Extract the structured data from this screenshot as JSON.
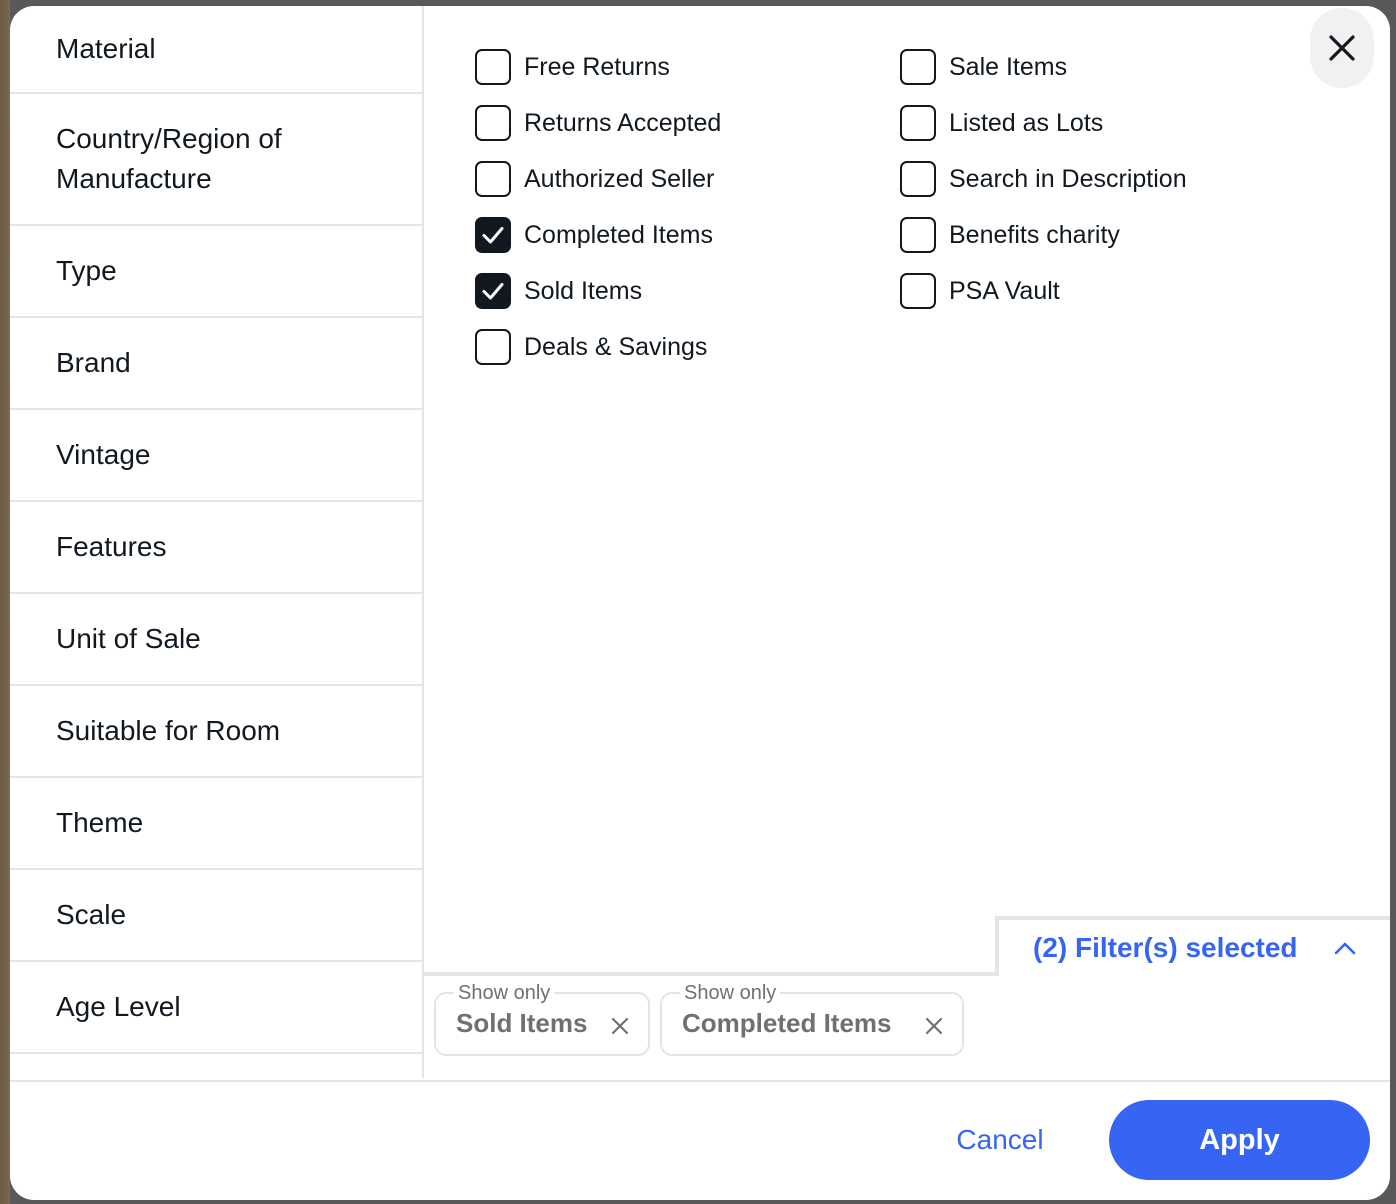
{
  "sidebar": {
    "items": [
      {
        "label": "Material"
      },
      {
        "label": "Country/Region of Manufacture"
      },
      {
        "label": "Type"
      },
      {
        "label": "Brand"
      },
      {
        "label": "Vintage"
      },
      {
        "label": "Features"
      },
      {
        "label": "Unit of Sale"
      },
      {
        "label": "Suitable for Room"
      },
      {
        "label": "Theme"
      },
      {
        "label": "Scale"
      },
      {
        "label": "Age Level"
      }
    ]
  },
  "options": {
    "left": [
      {
        "label": "Free Returns",
        "checked": false
      },
      {
        "label": "Returns Accepted",
        "checked": false
      },
      {
        "label": "Authorized Seller",
        "checked": false
      },
      {
        "label": "Completed Items",
        "checked": true
      },
      {
        "label": "Sold Items",
        "checked": true
      },
      {
        "label": "Deals & Savings",
        "checked": false
      }
    ],
    "right": [
      {
        "label": "Sale Items",
        "checked": false
      },
      {
        "label": "Listed as Lots",
        "checked": false
      },
      {
        "label": "Search in Description",
        "checked": false
      },
      {
        "label": "Benefits charity",
        "checked": false
      },
      {
        "label": "PSA Vault",
        "checked": false
      }
    ]
  },
  "filters_selected": {
    "label": "(2) Filter(s) selected",
    "chips": [
      {
        "legend": "Show only",
        "value": "Sold Items"
      },
      {
        "legend": "Show only",
        "value": "Completed Items"
      }
    ]
  },
  "footer": {
    "cancel_label": "Cancel",
    "apply_label": "Apply"
  },
  "colors": {
    "accent": "#3665f3",
    "text": "#111820",
    "muted": "#707070",
    "divider": "#e5e5e5"
  },
  "icons": {
    "close": "close-icon",
    "chevron": "chevron-up-icon",
    "chip_remove": "x-icon",
    "check": "checkmark-icon"
  }
}
